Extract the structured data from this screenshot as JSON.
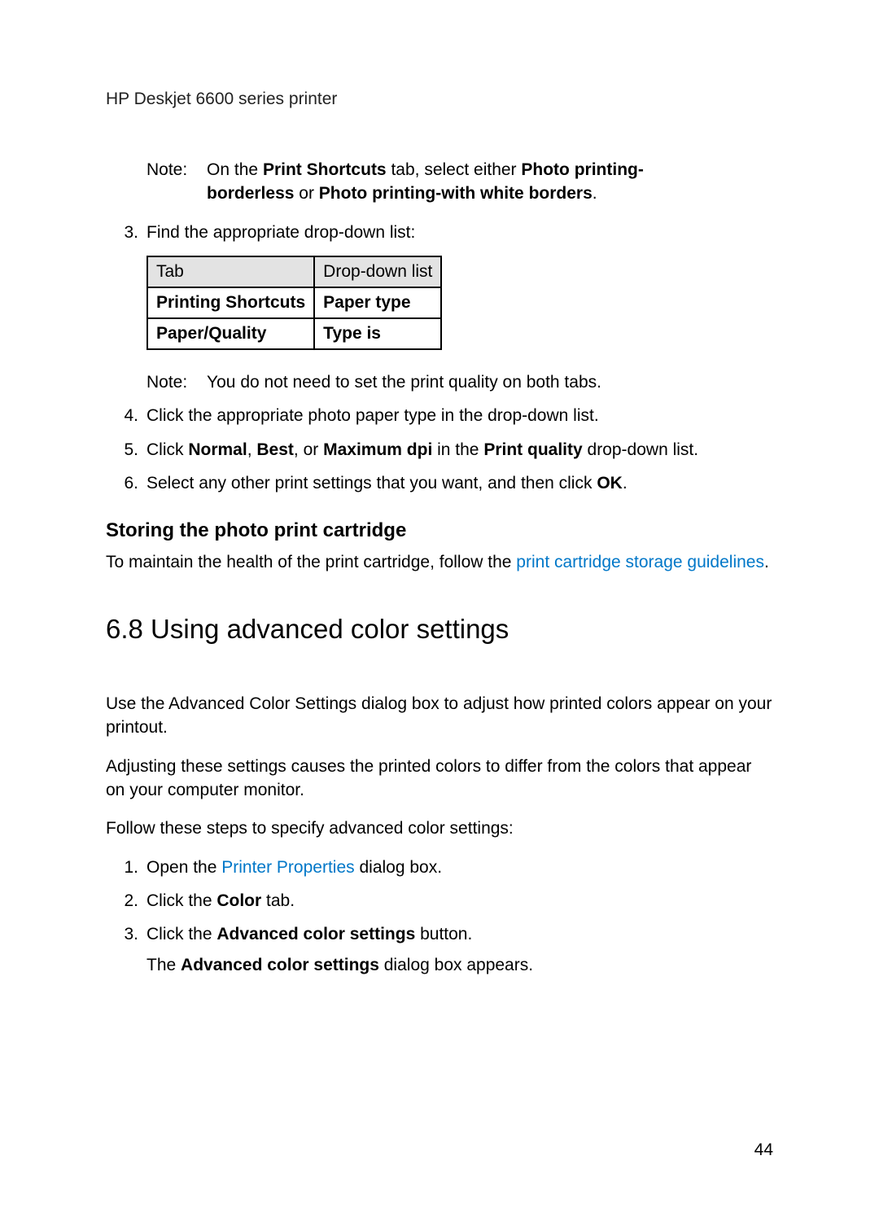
{
  "header": "HP Deskjet 6600 series printer",
  "note1": {
    "label": "Note:",
    "pre": "On the ",
    "bold1": "Print Shortcuts",
    "mid1": " tab, select either ",
    "bold2": "Photo printing-borderless",
    "mid2": " or ",
    "bold3": "Photo printing-with white borders",
    "end": "."
  },
  "step3": {
    "num": "3.",
    "text": "Find the appropriate drop-down list:"
  },
  "table": {
    "h1": "Tab",
    "h2": "Drop-down list",
    "r1c1": "Printing Shortcuts",
    "r1c2": "Paper type",
    "r2c1": "Paper/Quality",
    "r2c2": "Type is"
  },
  "note2": {
    "label": "Note:",
    "text": "You do not need to set the print quality on both tabs."
  },
  "step4": {
    "num": "4.",
    "text": "Click the appropriate photo paper type in the drop-down list."
  },
  "step5": {
    "num": "5.",
    "pre": "Click ",
    "b1": "Normal",
    "c1": ", ",
    "b2": "Best",
    "c2": ", or ",
    "b3": "Maximum dpi",
    "c3": " in the ",
    "b4": "Print quality",
    "end": " drop-down list."
  },
  "step6": {
    "num": "6.",
    "pre": "Select any other print settings that you want, and then click ",
    "b1": "OK",
    "end": "."
  },
  "h3": "Storing the photo print cartridge",
  "storage_para": {
    "pre": "To maintain the health of the print cartridge, follow the ",
    "link": "print cartridge storage guidelines",
    "end": "."
  },
  "h2": "6.8  Using advanced color settings",
  "p1": "Use the Advanced Color Settings dialog box to adjust how printed colors appear on your printout.",
  "p2": "Adjusting these settings causes the printed colors to differ from the colors that appear on your computer monitor.",
  "p3": "Follow these steps to specify advanced color settings:",
  "s1": {
    "num": "1.",
    "pre": "Open the ",
    "link": "Printer Properties",
    "end": " dialog box."
  },
  "s2": {
    "num": "2.",
    "pre": "Click the ",
    "b1": "Color",
    "end": " tab."
  },
  "s3": {
    "num": "3.",
    "pre": "Click the ",
    "b1": "Advanced color settings",
    "end": " button.",
    "sub_pre": "The ",
    "sub_b": "Advanced color settings",
    "sub_end": " dialog box appears."
  },
  "page_number": "44"
}
